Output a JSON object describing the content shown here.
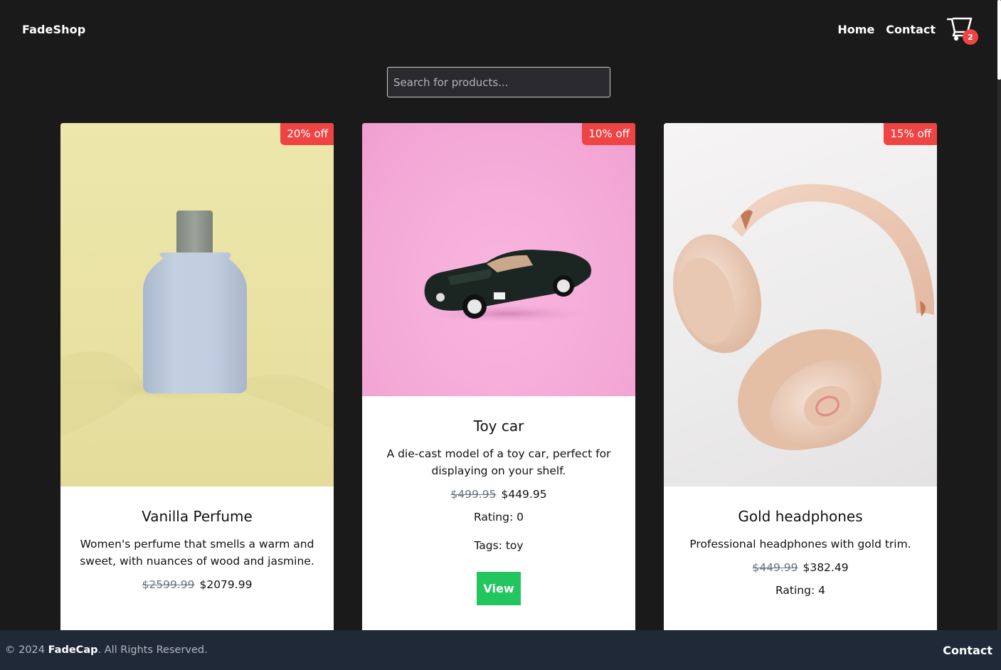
{
  "header": {
    "brand": "FadeShop",
    "nav": [
      {
        "label": "Home"
      },
      {
        "label": "Contact"
      }
    ],
    "cart_count": "2"
  },
  "search": {
    "placeholder": "Search for products..."
  },
  "products": [
    {
      "title": "Vanilla Perfume",
      "description": "Women's perfume that smells a warm and sweet, with nuances of wood and jasmine.",
      "old_price": "$2599.99",
      "price": "$2079.99",
      "discount": "20% off"
    },
    {
      "title": "Toy car",
      "description": "A die-cast model of a toy car, perfect for displaying on your shelf.",
      "old_price": "$499.95",
      "price": "$449.95",
      "discount": "10% off",
      "rating": "Rating: 0",
      "tags": "Tags: toy",
      "button": "View"
    },
    {
      "title": "Gold headphones",
      "description": "Professional headphones with gold trim.",
      "old_price": "$449.99",
      "price": "$382.49",
      "discount": "15% off",
      "rating": "Rating: 4"
    }
  ],
  "footer": {
    "copyright_prefix": "© 2024 ",
    "company": "FadeCap",
    "copyright_suffix": ". All Rights Reserved.",
    "contact": "Contact"
  },
  "colors": {
    "background": "#1a1a1a",
    "badge": "#ef4444",
    "button": "#22c55e",
    "footer": "#1f2937"
  }
}
